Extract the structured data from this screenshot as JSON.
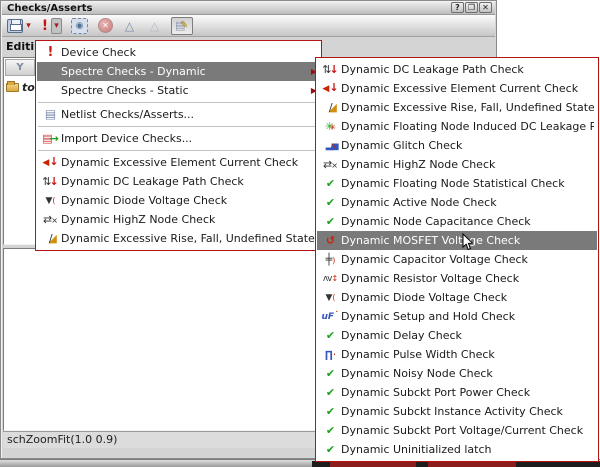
{
  "window": {
    "title": "Checks/Asserts",
    "controls": {
      "help": "?",
      "restore": "❐",
      "close": "✕"
    }
  },
  "toolbar": {
    "icons": [
      "save-icon",
      "save-dropdown-arrow-icon",
      "device-check-icon",
      "device-check-dropdown-arrow-icon",
      "selection-icon",
      "stop-icon",
      "filter-color-icon",
      "filter-gray-icon",
      "edit-checks-icon"
    ],
    "dropdown_glyph": "▾",
    "select_glyph": "◉",
    "stop_glyph": "✕",
    "funnel_glyph": "△"
  },
  "editing": {
    "label": "Editing"
  },
  "tree": {
    "filter_header_glyph": "Y",
    "folder_label": "to"
  },
  "status_bar": {
    "text": "schZoomFit(1.0 0.9)"
  },
  "colors": {
    "menu_border": "#b51414",
    "highlight_bg": "#7a7a7a",
    "check_green": "#1e9e1e",
    "alert_red": "#cc1111"
  },
  "menu": {
    "items": [
      {
        "label": "Device Check",
        "icon": "exclaim"
      },
      {
        "label": "Spectre Checks - Dynamic",
        "icon": "",
        "has_submenu": true,
        "highlighted": true
      },
      {
        "label": "Spectre Checks - Static",
        "icon": "",
        "has_submenu": true
      },
      {
        "label": "Netlist Checks/Asserts...",
        "icon": "netlist-doc"
      },
      {
        "label": "Import Device Checks...",
        "icon": "import"
      },
      {
        "label": "Dynamic Excessive Element Current Check",
        "icon": "current"
      },
      {
        "label": "Dynamic DC Leakage Path Check",
        "icon": "leakage"
      },
      {
        "label": "Dynamic Diode Voltage Check",
        "icon": "diode"
      },
      {
        "label": "Dynamic HighZ Node Check",
        "icon": "highz"
      },
      {
        "label": "Dynamic Excessive Rise, Fall, Undefined State Time Check",
        "icon": "risefall"
      }
    ]
  },
  "submenu": {
    "items": [
      {
        "label": "Dynamic DC Leakage Path Check",
        "icon": "leakage"
      },
      {
        "label": "Dynamic Excessive Element Current Check",
        "icon": "current"
      },
      {
        "label": "Dynamic Excessive Rise, Fall, Undefined State Time Check",
        "icon": "risefall"
      },
      {
        "label": "Dynamic Floating Node Induced DC Leakage Path Check",
        "icon": "floating"
      },
      {
        "label": "Dynamic Glitch Check",
        "icon": "glitch"
      },
      {
        "label": "Dynamic HighZ Node Check",
        "icon": "highz"
      },
      {
        "label": "Dynamic Floating Node Statistical Check",
        "icon": "check"
      },
      {
        "label": "Dynamic Active Node Check",
        "icon": "check"
      },
      {
        "label": "Dynamic Node Capacitance Check",
        "icon": "check"
      },
      {
        "label": "Dynamic MOSFET Voltage Check",
        "icon": "mosfet",
        "highlighted": true
      },
      {
        "label": "Dynamic Capacitor Voltage Check",
        "icon": "capacitor"
      },
      {
        "label": "Dynamic Resistor Voltage Check",
        "icon": "resistor"
      },
      {
        "label": "Dynamic Diode Voltage Check",
        "icon": "diode"
      },
      {
        "label": "Dynamic Setup and Hold Check",
        "icon": "setuphold"
      },
      {
        "label": "Dynamic Delay Check",
        "icon": "check"
      },
      {
        "label": "Dynamic Pulse Width Check",
        "icon": "pulse"
      },
      {
        "label": "Dynamic Noisy Node Check",
        "icon": "check"
      },
      {
        "label": "Dynamic Subckt Port Power Check",
        "icon": "check"
      },
      {
        "label": "Dynamic Subckt Instance Activity Check",
        "icon": "check"
      },
      {
        "label": "Dynamic Subckt Port Voltage/Current Check",
        "icon": "check"
      },
      {
        "label": "Dynamic Uninitialized latch",
        "icon": "check"
      }
    ]
  }
}
